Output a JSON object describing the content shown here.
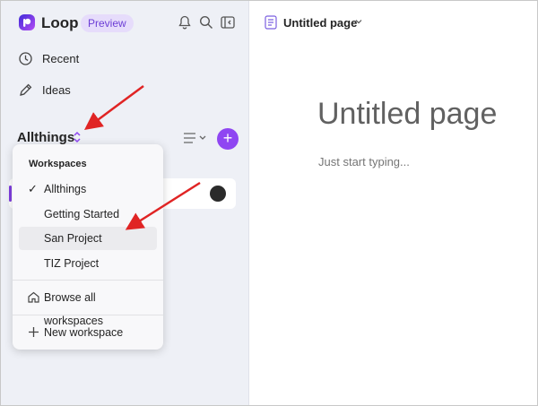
{
  "app": {
    "name": "Loop",
    "badge": "Preview"
  },
  "sidebar": {
    "nav": [
      {
        "label": "Recent"
      },
      {
        "label": "Ideas"
      }
    ],
    "workspace_title": "Allthings"
  },
  "workspace_menu": {
    "header": "Workspaces",
    "items": [
      {
        "label": "Allthings",
        "checked": true
      },
      {
        "label": "Getting Started"
      },
      {
        "label": "San Project"
      },
      {
        "label": "TIZ Project"
      }
    ],
    "browse_label": "Browse all workspaces",
    "new_label": "New workspace"
  },
  "main": {
    "breadcrumb": "Untitled page",
    "title": "Untitled page",
    "placeholder": "Just start typing..."
  },
  "colors": {
    "accent": "#8f46f2",
    "annotation_arrow": "#e02424"
  }
}
